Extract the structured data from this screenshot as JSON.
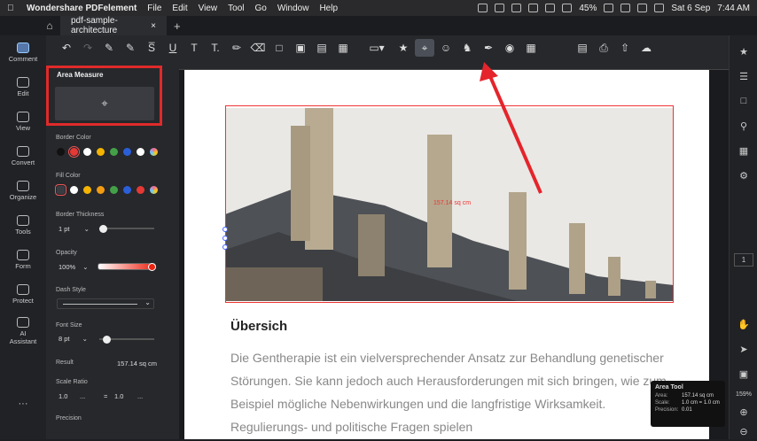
{
  "menubar": {
    "app": "Wondershare PDFelement",
    "items": [
      "File",
      "Edit",
      "View",
      "Tool",
      "Go",
      "Window",
      "Help"
    ],
    "battery": "45%",
    "date": "Sat 6 Sep",
    "time": "7:44 AM"
  },
  "tab": {
    "title": "pdf-sample-architecture",
    "close": "×",
    "add": "+"
  },
  "nav": [
    {
      "label": "Comment"
    },
    {
      "label": "Edit"
    },
    {
      "label": "View"
    },
    {
      "label": "Convert"
    },
    {
      "label": "Organize"
    },
    {
      "label": "Tools"
    },
    {
      "label": "Form"
    },
    {
      "label": "Protect"
    },
    {
      "label": "AI Assistant"
    }
  ],
  "nav_more": "···",
  "panel": {
    "title": "Area Measure",
    "border_color_label": "Border Color",
    "fill_color_label": "Fill Color",
    "border_thickness_label": "Border Thickness",
    "border_thickness": "1 pt",
    "opacity_label": "Opacity",
    "opacity": "100%",
    "dash_style_label": "Dash Style",
    "font_size_label": "Font Size",
    "font_size": "8 pt",
    "result_label": "Result",
    "result": "157.14 sq cm",
    "scale_ratio_label": "Scale Ratio",
    "scale_left": "1.0",
    "scale_right": "1.0",
    "scale_unit": "...",
    "equals": "=",
    "precision_label": "Precision",
    "colors": [
      "#111111",
      "#e53935",
      "#ffffff",
      "#f5b400",
      "#43a047",
      "#2b5fd9",
      "#ffffff",
      "#f06aa0"
    ]
  },
  "document": {
    "measure_label": "157.14 sq cm",
    "heading": "Übersich",
    "body": "Die Gentherapie ist ein vielversprechender Ansatz zur Behandlung genetischer Störungen. Sie kann jedoch auch Herausforderungen mit sich bringen, wie zum Beispiel mögliche Nebenwirkungen und die langfristige Wirksamkeit. Regulierungs- und politische Fragen spielen"
  },
  "rightbar": {
    "page": "1",
    "zoom": "159%"
  },
  "tooltip": {
    "title": "Area Tool",
    "area_label": "Area:",
    "area": "157.14 sq cm",
    "scale_label": "Scale:",
    "scale": "1.0 cm = 1.0 cm",
    "precision_label": "Precision:",
    "precision": "0.01"
  }
}
